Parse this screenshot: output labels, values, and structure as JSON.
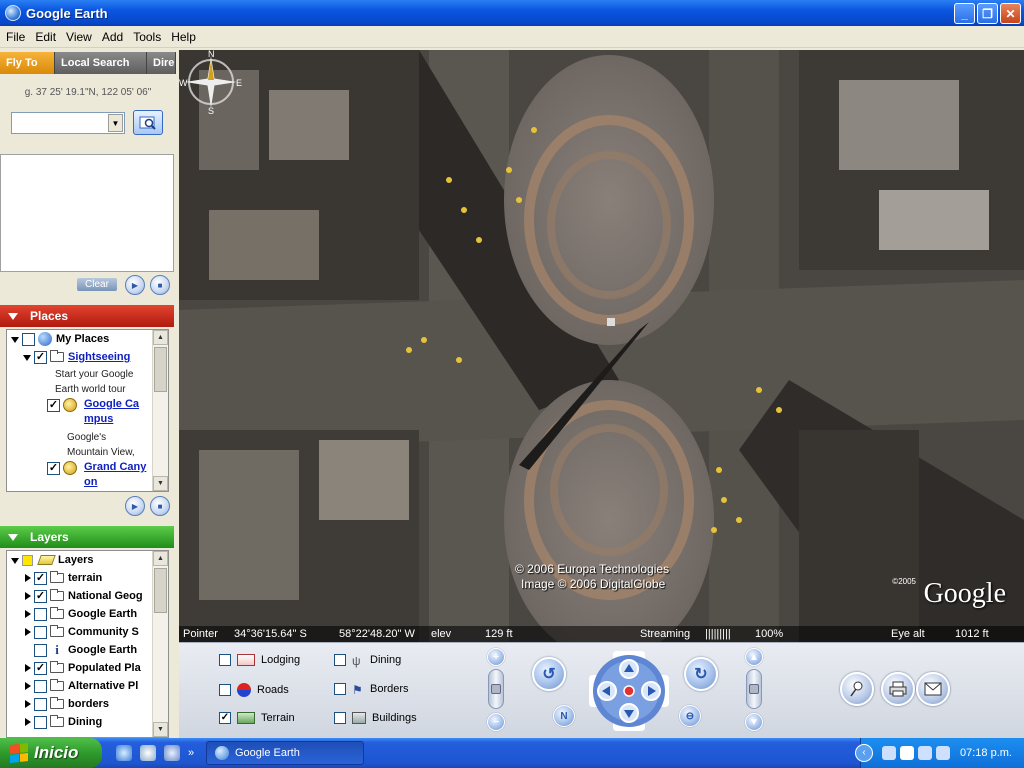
{
  "window": {
    "title": "Google Earth"
  },
  "menu": [
    "File",
    "Edit",
    "View",
    "Add",
    "Tools",
    "Help"
  ],
  "search_tabs": [
    {
      "label": "Fly To",
      "active": true
    },
    {
      "label": "Local Search",
      "active": false
    },
    {
      "label": "Dire",
      "active": false
    }
  ],
  "flyto": {
    "coords_hint": "g. 37 25' 19.1\"N, 122 05' 06\"",
    "input_value": "",
    "clear_label": "Clear"
  },
  "places": {
    "header": "Places",
    "items": {
      "my_places": "My Places",
      "sightseeing": "Sightseeing",
      "sightseeing_desc": "Start your Google Earth world tour",
      "google_campus": "Google Ca mpus",
      "google_campus_desc": "Google's Mountain View,",
      "grand_canyon": "Grand Cany on"
    }
  },
  "layers": {
    "header": "Layers",
    "root": "Layers",
    "items": [
      {
        "label": "terrain",
        "checked": true,
        "expand": true,
        "icon": "folder"
      },
      {
        "label": "National Geog",
        "checked": true,
        "expand": true,
        "icon": "folder"
      },
      {
        "label": "Google Earth",
        "checked": false,
        "expand": true,
        "icon": "folder"
      },
      {
        "label": "Community S",
        "checked": false,
        "expand": true,
        "icon": "folder"
      },
      {
        "label": "Google Earth",
        "checked": false,
        "expand": false,
        "icon": "info"
      },
      {
        "label": "Populated Pla",
        "checked": true,
        "expand": true,
        "icon": "folder"
      },
      {
        "label": "Alternative Pl",
        "checked": false,
        "expand": true,
        "icon": "folder"
      },
      {
        "label": "borders",
        "checked": false,
        "expand": true,
        "icon": "folder"
      },
      {
        "label": "Dining",
        "checked": false,
        "expand": true,
        "icon": "folder"
      }
    ]
  },
  "map": {
    "attribution_line1": "© 2006 Europa Technologies",
    "attribution_line2": "Image © 2006 DigitalGlobe",
    "logo": "Google",
    "logo_copy": "©2005",
    "compass_n": "N",
    "compass_e": "E",
    "compass_s": "S",
    "compass_w": "W",
    "status": {
      "pointer_label": "Pointer",
      "lat": "34°36'15.64\" S",
      "lon": "58°22'48.20\" W",
      "elev_label": "elev",
      "elev_value": "129 ft",
      "streaming_label": "Streaming",
      "streaming_bars": "|||||||||",
      "streaming_pct": "100%",
      "eye_label": "Eye  alt",
      "eye_value": "1012 ft"
    }
  },
  "layer_toggles": [
    {
      "label": "Lodging",
      "checked": false
    },
    {
      "label": "Roads",
      "checked": false
    },
    {
      "label": "Terrain",
      "checked": true
    },
    {
      "label": "Dining",
      "checked": false
    },
    {
      "label": "Borders",
      "checked": false
    },
    {
      "label": "Buildings",
      "checked": false
    }
  ],
  "taskbar": {
    "start_label": "Inicio",
    "task_label": "Google Earth",
    "clock": "07:18 p.m."
  }
}
